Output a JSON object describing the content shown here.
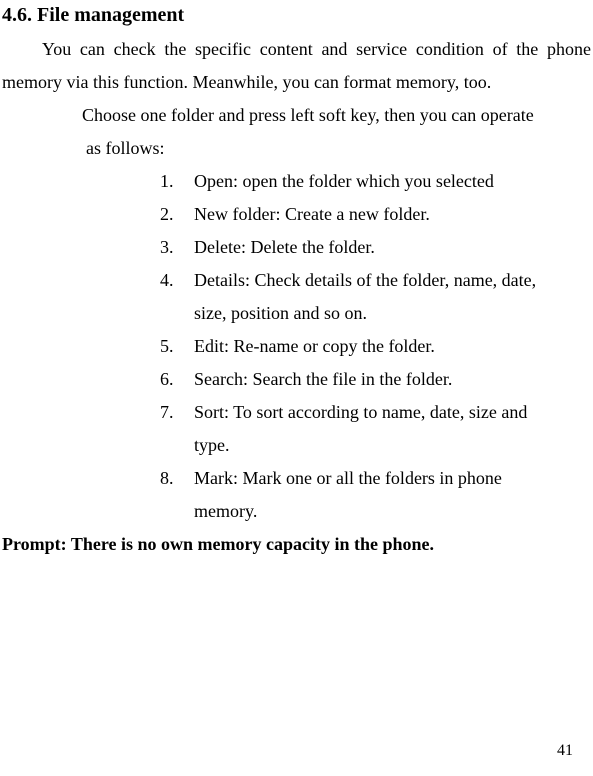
{
  "heading": "4.6.   File management",
  "intro": "You can check the specific content and service condition of the phone memory via this function. Meanwhile, you can format memory, too.",
  "instruction": "Choose one folder and press left soft key, then you can operate as follows:",
  "items": [
    "Open: open the folder which you selected",
    "New folder: Create a new folder.",
    "Delete: Delete the folder.",
    "Details: Check details of the folder, name, date, size, position and so on.",
    "Edit: Re-name or copy the folder.",
    "Search: Search the file in the folder.",
    "Sort: To sort according to name, date, size and type.",
    "Mark: Mark one or all the folders in phone memory."
  ],
  "prompt": "Prompt: There is no own memory capacity in the phone.",
  "page_number": "41"
}
